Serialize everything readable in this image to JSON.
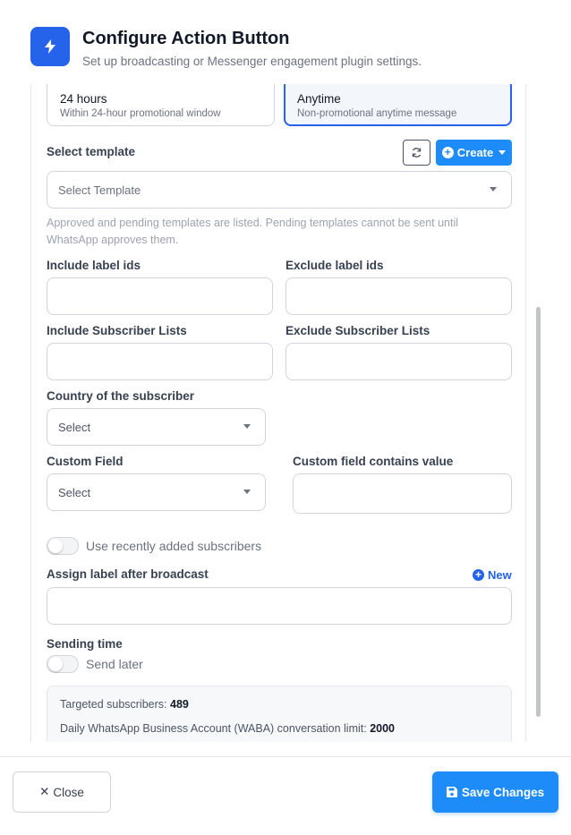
{
  "header": {
    "title": "Configure Action Button",
    "subtitle": "Set up broadcasting or Messenger engagement plugin settings.",
    "icon": "lightning-icon"
  },
  "message_window": {
    "options": [
      {
        "title": "24 hours",
        "desc": "Within 24-hour promotional window",
        "selected": false
      },
      {
        "title": "Anytime",
        "desc": "Non-promotional anytime message",
        "selected": true
      }
    ]
  },
  "template": {
    "label": "Select template",
    "refresh_icon": "refresh-icon",
    "create_label": "Create",
    "placeholder": "Select Template",
    "help": "Approved and pending templates are listed. Pending templates cannot be sent until WhatsApp approves them."
  },
  "filters": {
    "include_label_ids": "Include label ids",
    "exclude_label_ids": "Exclude label ids",
    "include_lists": "Include Subscriber Lists",
    "exclude_lists": "Exclude Subscriber Lists",
    "country_label": "Country of the subscriber",
    "country_value": "Select",
    "custom_field_label": "Custom Field",
    "custom_field_value": "Select",
    "custom_value_label": "Custom field contains value"
  },
  "recent": {
    "label": "Use recently added subscribers",
    "enabled": false
  },
  "assign": {
    "label": "Assign label after broadcast",
    "new_label": "New"
  },
  "sending": {
    "label": "Sending time",
    "toggle_label": "Send later",
    "enabled": false
  },
  "stats": {
    "targeted_label": "Targeted subscribers:",
    "targeted_value": "489",
    "limit_label": "Daily WhatsApp Business Account (WABA) conversation limit:",
    "limit_value": "2000"
  },
  "footer": {
    "close_label": "Close",
    "save_label": "Save Changes"
  },
  "colors": {
    "primary": "#2563eb",
    "button_blue": "#1d8cf8"
  }
}
